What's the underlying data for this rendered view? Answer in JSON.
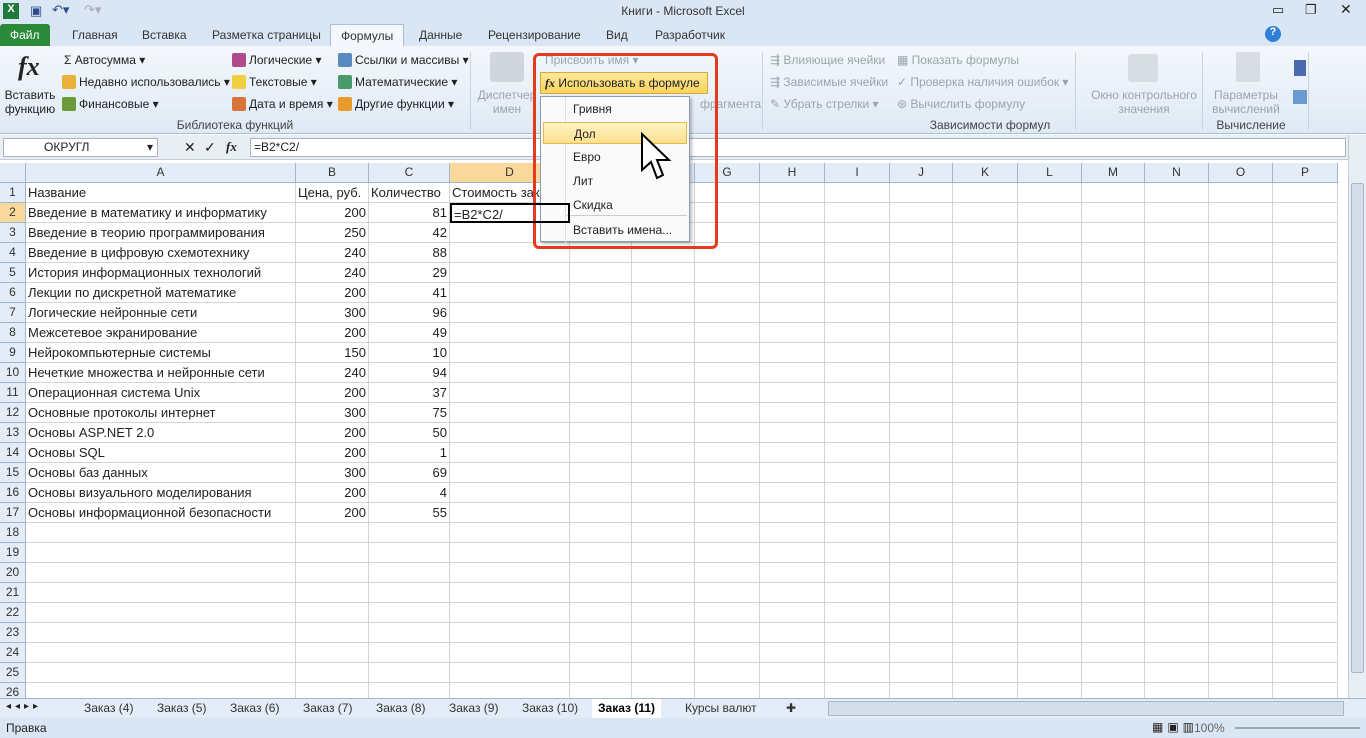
{
  "window": {
    "title": "Книги - Microsoft Excel"
  },
  "ribbon_tabs": [
    "Файл",
    "Главная",
    "Вставка",
    "Разметка страницы",
    "Формулы",
    "Данные",
    "Рецензирование",
    "Вид",
    "Разработчик"
  ],
  "ribbon": {
    "insert_function": "Вставить функцию",
    "autosum": "Автосумма",
    "recent": "Недавно использовались",
    "financial": "Финансовые",
    "logical": "Логические",
    "text": "Текстовые",
    "datetime": "Дата и время",
    "lookup": "Ссылки и массивы",
    "math": "Математические",
    "other": "Другие функции",
    "library_group": "Библиотека функций",
    "name_manager": "Диспетчер имен",
    "define_name": "Присвоить имя",
    "use_in_formula": "Использовать в формуле",
    "create_from_selection": "фрагмента",
    "trace_precedents": "Влияющие ячейки",
    "trace_dependents": "Зависимые ячейки",
    "remove_arrows": "Убрать стрелки",
    "show_formulas": "Показать формулы",
    "error_checking": "Проверка наличия ошибок",
    "evaluate": "Вычислить формулу",
    "auditing_group": "Зависимости формул",
    "watch": "Окно контрольного значения",
    "calc_options": "Параметры вычислений",
    "calc_group": "Вычисление"
  },
  "formula_bar": {
    "name_box": "ОКРУГЛ",
    "formula": "=B2*C2/"
  },
  "dropdown": {
    "items": [
      "Гривня",
      "Дол",
      "Евро",
      "Лит",
      "Скидка"
    ],
    "highlighted": "Дол",
    "paste_names": "Вставить имена..."
  },
  "columns": [
    "A",
    "B",
    "C",
    "D",
    "E",
    "F",
    "G",
    "H",
    "I",
    "J",
    "K",
    "L",
    "M",
    "N",
    "O",
    "P"
  ],
  "headers": [
    "Название",
    "Цена, руб.",
    "Количество",
    "Стоимость заказа"
  ],
  "rows": [
    [
      "Введение в математику и информатику",
      "200",
      "81"
    ],
    [
      "Введение в теорию программирования",
      "250",
      "42"
    ],
    [
      "Введение в цифровую схемотехнику",
      "240",
      "88"
    ],
    [
      "История информационных технологий",
      "240",
      "29"
    ],
    [
      "Лекции по дискретной математике",
      "200",
      "41"
    ],
    [
      "Логические нейронные сети",
      "300",
      "96"
    ],
    [
      "Межсетевое экранирование",
      "200",
      "49"
    ],
    [
      "Нейрокомпьютерные системы",
      "150",
      "10"
    ],
    [
      "Нечеткие множества и нейронные сети",
      "240",
      "94"
    ],
    [
      "Операционная система Unix",
      "200",
      "37"
    ],
    [
      "Основные протоколы интернет",
      "300",
      "75"
    ],
    [
      "Основы ASP.NET 2.0",
      "200",
      "50"
    ],
    [
      "Основы SQL",
      "200",
      "1"
    ],
    [
      "Основы баз данных",
      "300",
      "69"
    ],
    [
      "Основы визуального моделирования",
      "200",
      "4"
    ],
    [
      "Основы информационной безопасности",
      "200",
      "55"
    ]
  ],
  "active_cell_value": "=B2*C2/",
  "sheets": [
    "Заказ (4)",
    "Заказ (5)",
    "Заказ (6)",
    "Заказ (7)",
    "Заказ (8)",
    "Заказ (9)",
    "Заказ (10)",
    "Заказ (11)",
    "Курсы валют"
  ],
  "active_sheet": "Заказ (11)",
  "status": {
    "mode": "Правка",
    "zoom": "100%"
  }
}
